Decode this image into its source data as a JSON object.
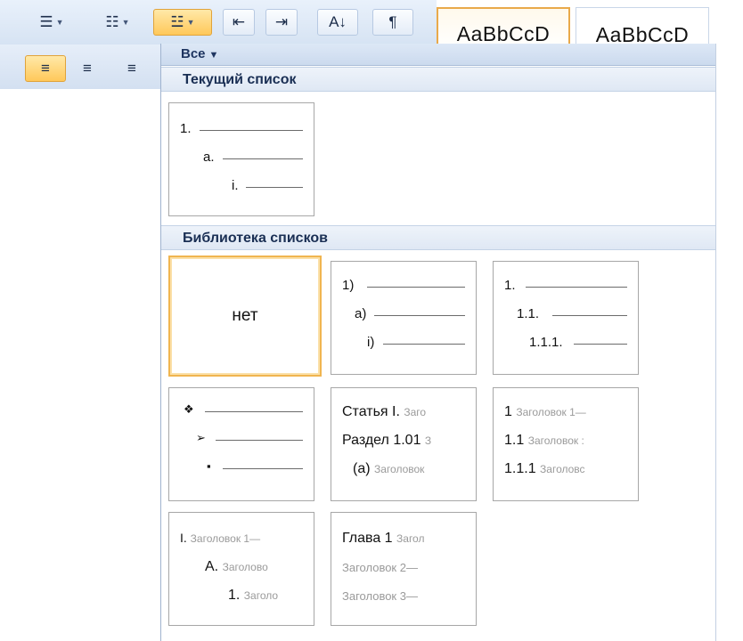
{
  "toolbar": {
    "styles": [
      "AaBbCcD",
      "AaBbCcD"
    ]
  },
  "panel": {
    "filter_label": "Все",
    "current_list_heading": "Текущий список",
    "library_heading": "Библиотека списков",
    "current_list_tile": [
      "1.",
      "a.",
      "i."
    ],
    "library": {
      "none_label": "нет",
      "numbered_paren": [
        "1)",
        "a)",
        "i)"
      ],
      "numbered_decimal": [
        "1.",
        "1.1.",
        "1.1.1."
      ],
      "bullets": [
        "❖",
        "➢",
        "▪"
      ],
      "article": [
        {
          "prefix": "Статья I.",
          "rest": "Заго"
        },
        {
          "prefix": "Раздел 1.01",
          "rest": "З"
        },
        {
          "prefix": "(a)",
          "rest": "Заголовок"
        }
      ],
      "heading_numbered": [
        {
          "prefix": "1",
          "rest": "Заголовок 1—"
        },
        {
          "prefix": "1.1",
          "rest": "Заголовок :"
        },
        {
          "prefix": "1.1.1",
          "rest": "Заголовс"
        }
      ],
      "roman_headings": [
        {
          "prefix": "I.",
          "rest": "Заголовок 1—"
        },
        {
          "prefix": "A.",
          "rest": "Заголово"
        },
        {
          "prefix": "1.",
          "rest": "Заголо"
        }
      ],
      "chapter": {
        "prefix": "Глава 1",
        "rest": "Загол",
        "line2": "Заголовок 2—",
        "line3": "Заголовок 3—"
      }
    }
  }
}
